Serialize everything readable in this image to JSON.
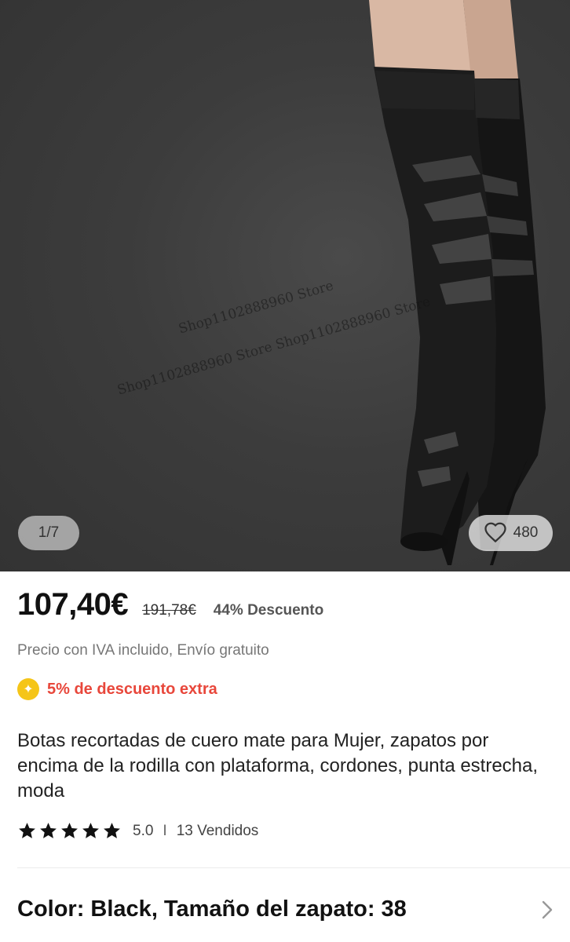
{
  "gallery": {
    "page_counter": "1/7",
    "wishlist_count": "480",
    "watermarks": [
      "Shop1102888960 Store",
      "Shop1102888960 Store Shop1102888960 Store"
    ]
  },
  "price": {
    "current": "107,40€",
    "original": "191,78€",
    "discount": "44% Descuento"
  },
  "tax_note": "Precio con IVA incluido, Envío gratuito",
  "extra_discount": "5% de descuento extra",
  "product_title": "Botas recortadas de cuero mate para Mujer, zapatos por encima de la rodilla con plataforma, cordones, punta estrecha, moda",
  "rating": {
    "stars": 5,
    "value": "5.0",
    "separator": "I",
    "sold": "13 Vendidos"
  },
  "variant": {
    "label": "Color: Black, Tamaño del zapato: 38"
  },
  "colors": {
    "accent_red": "#e8473b",
    "coin_yellow": "#f5c518"
  }
}
